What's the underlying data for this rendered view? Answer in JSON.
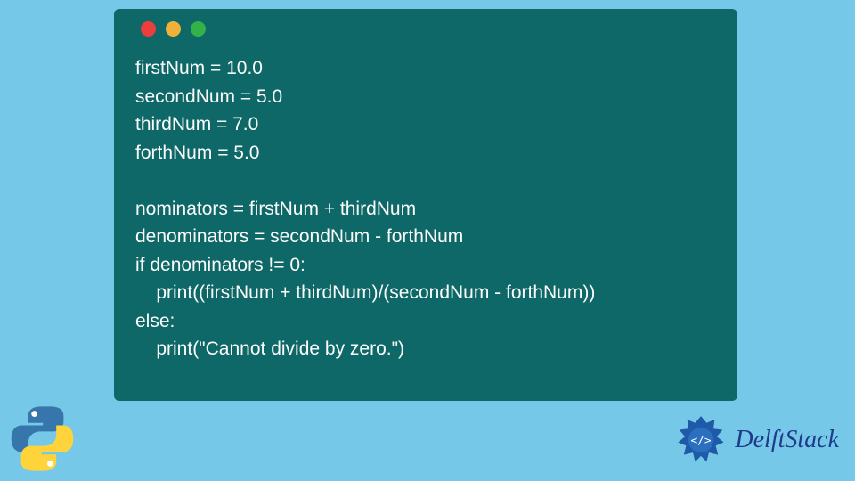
{
  "code": {
    "lines": [
      "firstNum = 10.0",
      "secondNum = 5.0",
      "thirdNum = 7.0",
      "forthNum = 5.0",
      "",
      "nominators = firstNum + thirdNum",
      "denominators = secondNum - forthNum",
      "if denominators != 0:",
      "    print((firstNum + thirdNum)/(secondNum - forthNum))",
      "else:",
      "    print(\"Cannot divide by zero.\")"
    ]
  },
  "brand": {
    "name": "DelftStack"
  },
  "traffic_lights": [
    "red",
    "yellow",
    "green"
  ],
  "colors": {
    "page_bg": "#76c8e8",
    "window_bg": "#0f6868",
    "code_text": "#fcfcfc",
    "brand_text": "#1e3a8a"
  }
}
